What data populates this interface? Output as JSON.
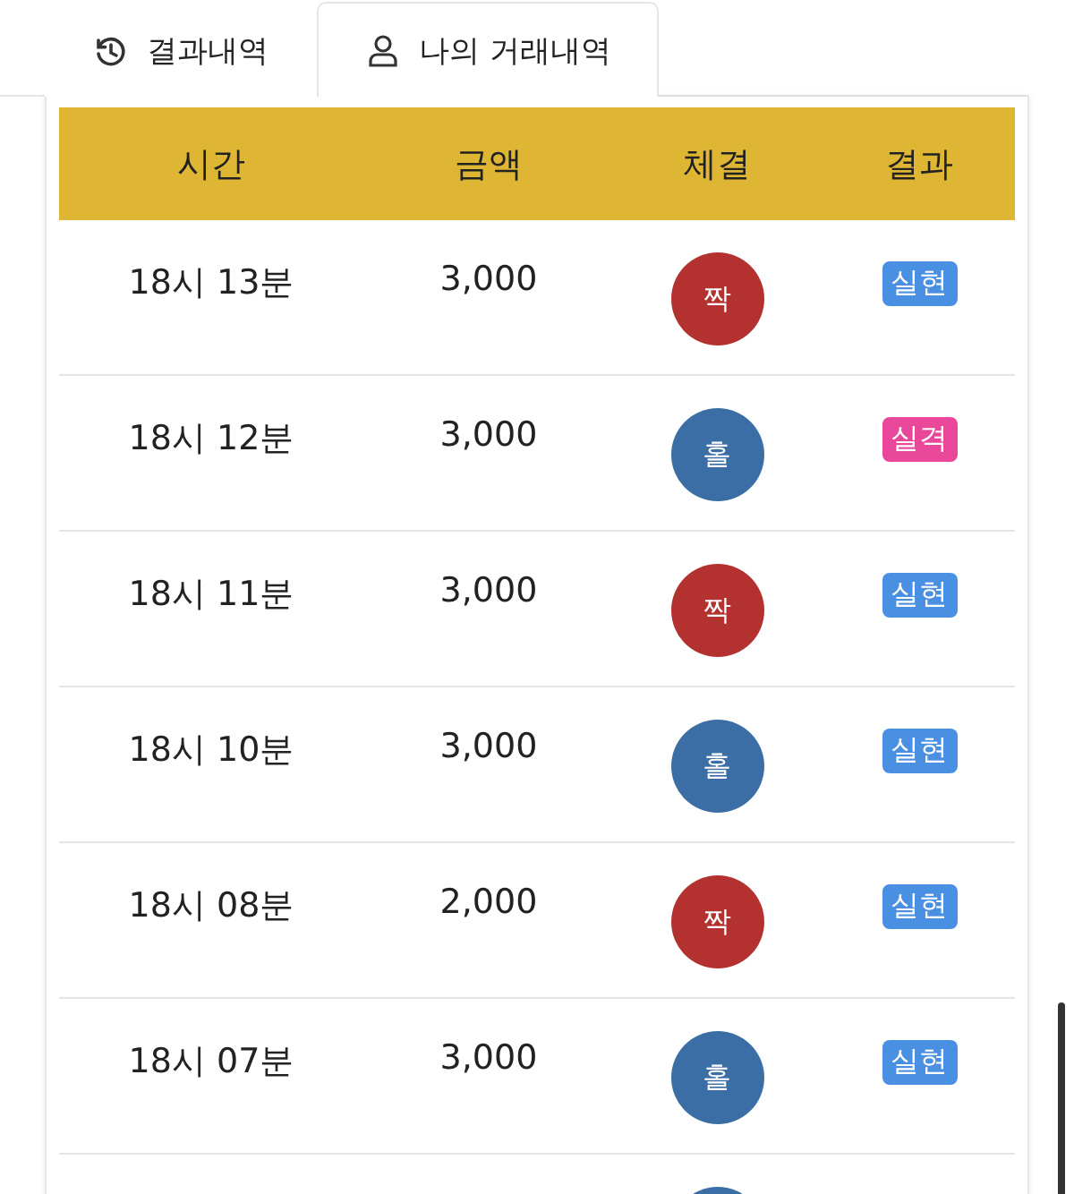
{
  "tabs": [
    {
      "label": "결과내역",
      "kind": "history",
      "selected": false
    },
    {
      "label": "나의 거래내역",
      "kind": "account",
      "selected": true
    }
  ],
  "table": {
    "columns": [
      "시간",
      "금액",
      "체결",
      "결과"
    ],
    "rows": [
      {
        "time": "18시 13분",
        "amount": "3,000",
        "ball": {
          "text": "짝",
          "kind": "even"
        },
        "result": {
          "text": "실현",
          "kind": "hit"
        }
      },
      {
        "time": "18시 12분",
        "amount": "3,000",
        "ball": {
          "text": "홀",
          "kind": "odd"
        },
        "result": {
          "text": "실격",
          "kind": "miss"
        }
      },
      {
        "time": "18시 11분",
        "amount": "3,000",
        "ball": {
          "text": "짝",
          "kind": "even"
        },
        "result": {
          "text": "실현",
          "kind": "hit"
        }
      },
      {
        "time": "18시 10분",
        "amount": "3,000",
        "ball": {
          "text": "홀",
          "kind": "odd"
        },
        "result": {
          "text": "실현",
          "kind": "hit"
        }
      },
      {
        "time": "18시 08분",
        "amount": "2,000",
        "ball": {
          "text": "짝",
          "kind": "even"
        },
        "result": {
          "text": "실현",
          "kind": "hit"
        }
      },
      {
        "time": "18시 07분",
        "amount": "3,000",
        "ball": {
          "text": "홀",
          "kind": "odd"
        },
        "result": {
          "text": "실현",
          "kind": "hit"
        }
      },
      {
        "ball": {
          "kind": "odd"
        }
      }
    ]
  }
}
